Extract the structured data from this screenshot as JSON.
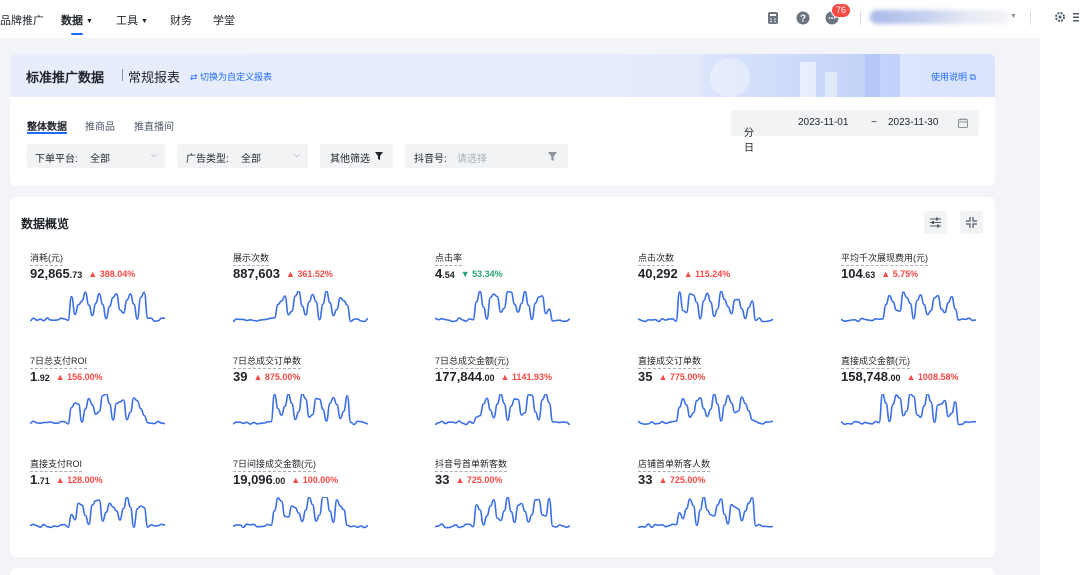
{
  "nav": {
    "items": [
      "品牌推广",
      "数据",
      "工具",
      "财务",
      "学堂"
    ],
    "active_index": 1,
    "badge_count": "76"
  },
  "report": {
    "title": "标准推广数据",
    "subtitle": "常规报表",
    "switch_label": "⇄ 切换为自定义报表",
    "help_label": "使用说明"
  },
  "tabs": [
    "整体数据",
    "推商品",
    "推直播间"
  ],
  "date": {
    "granularity": "分日",
    "start": "2023-11-01",
    "separator": "~",
    "end": "2023-11-30"
  },
  "filters": {
    "platform_label": "下单平台:",
    "platform_value": "全部",
    "adtype_label": "广告类型:",
    "adtype_value": "全部",
    "other_label": "其他筛选",
    "douyin_label": "抖音号:",
    "douyin_placeholder": "请选择"
  },
  "overview": {
    "title": "数据概览",
    "metrics": [
      {
        "name": "消耗(元)",
        "int": "92,865",
        "dec": ".73",
        "change": "▲ 388.04%",
        "dir": "up"
      },
      {
        "name": "展示次数",
        "int": "887,603",
        "dec": "",
        "change": "▲ 361.52%",
        "dir": "up"
      },
      {
        "name": "点击率",
        "int": "4",
        "dec": ".54",
        "change": "▼ 53.34%",
        "dir": "down"
      },
      {
        "name": "点击次数",
        "int": "40,292",
        "dec": "",
        "change": "▲ 115.24%",
        "dir": "up"
      },
      {
        "name": "平均千次展现费用(元)",
        "int": "104",
        "dec": ".63",
        "change": "▲ 5.75%",
        "dir": "up"
      },
      {
        "name": "7日总支付ROI",
        "int": "1",
        "dec": ".92",
        "change": "▲ 156.00%",
        "dir": "up"
      },
      {
        "name": "7日总成交订单数",
        "int": "39",
        "dec": "",
        "change": "▲ 875.00%",
        "dir": "up"
      },
      {
        "name": "7日总成交金额(元)",
        "int": "177,844",
        "dec": ".00",
        "change": "▲ 1141.93%",
        "dir": "up"
      },
      {
        "name": "直接成交订单数",
        "int": "35",
        "dec": "",
        "change": "▲ 775.00%",
        "dir": "up"
      },
      {
        "name": "直接成交金额(元)",
        "int": "158,748",
        "dec": ".00",
        "change": "▲ 1008.58%",
        "dir": "up"
      },
      {
        "name": "直接支付ROI",
        "int": "1",
        "dec": ".71",
        "change": "▲ 128.00%",
        "dir": "up"
      },
      {
        "name": "7日间接成交金额(元)",
        "int": "19,096",
        "dec": ".00",
        "change": "▲ 100.00%",
        "dir": "up"
      },
      {
        "name": "抖音号首单新客数",
        "int": "33",
        "dec": "",
        "change": "▲ 725.00%",
        "dir": "up"
      },
      {
        "name": "店铺首单新客人数",
        "int": "33",
        "dec": "",
        "change": "▲ 725.00%",
        "dir": "up"
      }
    ]
  },
  "colors": {
    "accent": "#1f6bff",
    "up": "#f54a45",
    "down": "#2ba471",
    "spark": "#3a6fe8"
  }
}
